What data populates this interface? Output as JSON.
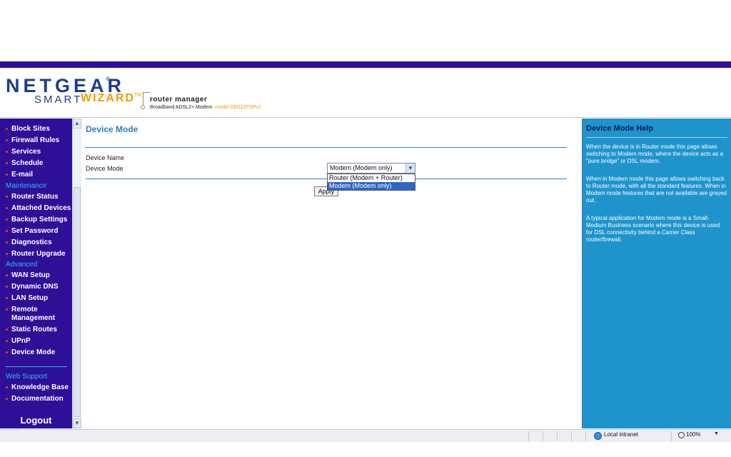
{
  "header": {
    "logo_netgear": "NETGEAR",
    "logo_reg": "®",
    "logo_smart": "SMART",
    "logo_wizard": "WIZARD",
    "logo_tm": "TM",
    "router_manager": "router manager",
    "product": "Broadband ADSL2+ Modem",
    "model": "model DM111PSPv2"
  },
  "sidebar": {
    "items_a": [
      "Block Sites",
      "Firewall Rules",
      "Services",
      "Schedule",
      "E-mail"
    ],
    "section_maintenance": "Maintenance",
    "items_b": [
      "Router Status",
      "Attached Devices",
      "Backup Settings",
      "Set Password",
      "Diagnostics",
      "Router Upgrade"
    ],
    "section_advanced": "Advanced",
    "items_c": [
      "WAN Setup",
      "Dynamic DNS",
      "LAN Setup",
      "Remote Management",
      "Static Routes",
      "UPnP",
      "Device Mode"
    ],
    "section_web_support": "Web Support",
    "items_d": [
      "Knowledge Base",
      "Documentation"
    ],
    "logout": "Logout"
  },
  "main": {
    "title": "Device Mode",
    "device_name_label": "Device Name",
    "device_mode_label": "Device Mode",
    "device_mode_value": "Modem (Modem only)",
    "options": [
      "Router (Modem + Router)",
      "Modem (Modem only)"
    ],
    "apply": "Apply"
  },
  "help": {
    "title": "Device Mode Help",
    "p1": "When the device is in Router mode this page allows switching to Modem mode, where the device acts as a \"pure bridge\" or DSL modem.",
    "p2": "When in Modem mode this page allows switching back to Router mode, with all the standard features. When in Modem mode features that are not available are grayed out.",
    "p3": "A typical application for Modem mode is a Small-Medium Business scenario where this device is used for DSL connectivity behind a Carrier Class router/firewall."
  },
  "statusbar": {
    "zone": "Local intranet",
    "zoom": "100%"
  },
  "colors": {
    "nav_bg": "#2d0f98",
    "accent_red": "#e8301d",
    "section_blue": "#2fb8f0",
    "title_blue": "#2a7fc7",
    "help_bg": "#1f94cc",
    "wizard_orange": "#f29a00"
  }
}
